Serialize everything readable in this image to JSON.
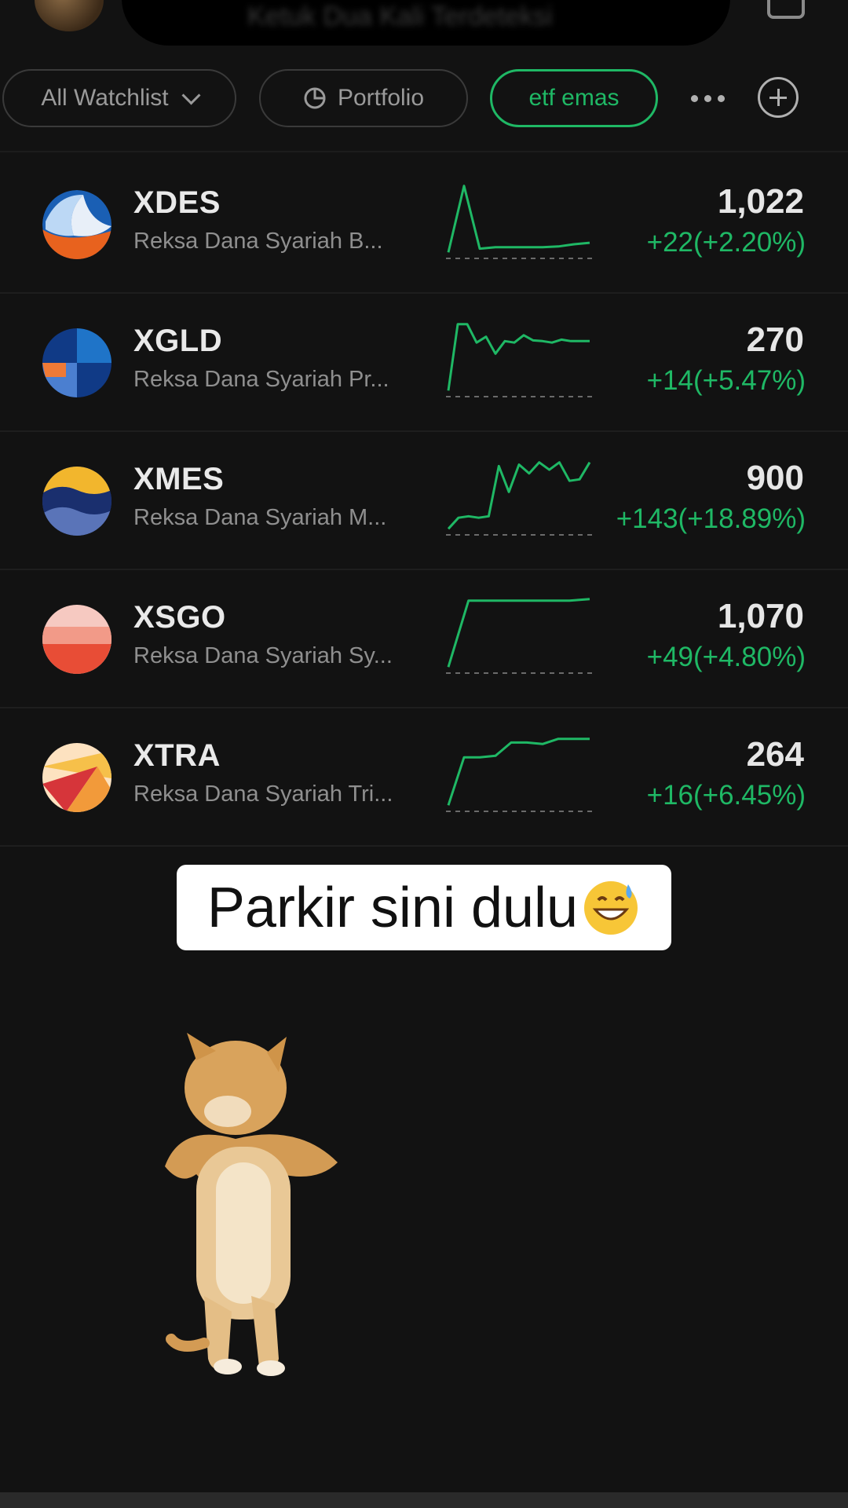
{
  "header": {
    "search_text": "Ketuk Dua Kali Terdeteksi"
  },
  "chips": {
    "all_watchlist": "All Watchlist",
    "portfolio": "Portfolio",
    "active": "etf emas"
  },
  "colors": {
    "background": "#121212",
    "positive": "#1fb865",
    "accent": "#1fb865"
  },
  "rows": [
    {
      "ticker": "XDES",
      "name": "Reksa Dana Syariah B...",
      "price": "1,022",
      "change": "+22(+2.20%)",
      "spark": [
        5,
        95,
        10,
        12,
        12,
        12,
        12,
        13,
        16,
        18
      ]
    },
    {
      "ticker": "XGLD",
      "name": "Reksa Dana Syariah Pr...",
      "price": "270",
      "change": "+14(+5.47%)",
      "spark": [
        5,
        95,
        95,
        70,
        78,
        55,
        72,
        70,
        80,
        73,
        72,
        70,
        74,
        72,
        72,
        72
      ]
    },
    {
      "ticker": "XMES",
      "name": "Reksa Dana Syariah M...",
      "price": "900",
      "change": "+143(+18.89%)",
      "spark": [
        5,
        20,
        22,
        20,
        22,
        90,
        55,
        92,
        80,
        95,
        85,
        95,
        70,
        72,
        95
      ]
    },
    {
      "ticker": "XSGO",
      "name": "Reksa Dana Syariah Sy...",
      "price": "1,070",
      "change": "+49(+4.80%)",
      "spark": [
        5,
        95,
        95,
        95,
        95,
        95,
        95,
        97
      ]
    },
    {
      "ticker": "XTRA",
      "name": "Reksa Dana Syariah Tri...",
      "price": "264",
      "change": "+16(+6.45%)",
      "spark": [
        5,
        70,
        70,
        72,
        90,
        90,
        88,
        95,
        95,
        95
      ]
    }
  ],
  "caption": {
    "text": "Parkir sini dulu",
    "emoji": "grinning-face-with-sweat"
  }
}
